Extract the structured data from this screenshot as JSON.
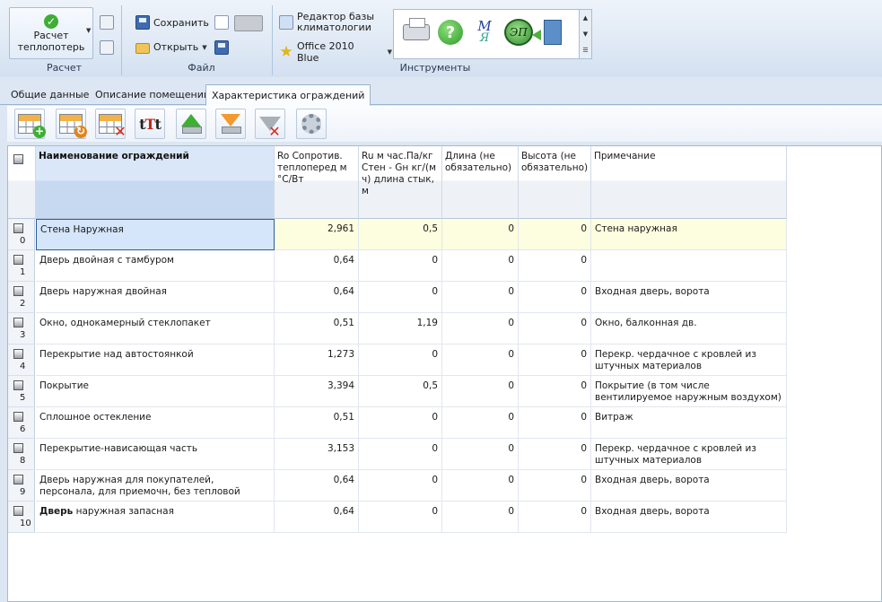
{
  "ribbon": {
    "calc": {
      "button_label": "Расчет теплопотерь",
      "group": "Расчет"
    },
    "file": {
      "save": "Сохранить",
      "open": "Открыть",
      "group": "Файл"
    },
    "tools": {
      "climate_editor": "Редактор базы климатологии",
      "theme": "Office 2010 Blue",
      "group": "Инструменты",
      "icons": [
        "printer-icon",
        "help-icon",
        "mz-logo-icon",
        "ep-logo-icon",
        "exit-door-icon"
      ]
    }
  },
  "tabs": [
    {
      "label": "Общие данные",
      "active": false
    },
    {
      "label": "Описание помещений",
      "active": false
    },
    {
      "label": "Характеристика ограждений",
      "active": true
    }
  ],
  "toolbar": {
    "icons": [
      "add-row-icon",
      "edit-row-icon",
      "delete-row-icon",
      "text-format-icon",
      "import-up-icon",
      "export-down-icon",
      "clear-filter-icon",
      "settings-icon"
    ]
  },
  "table": {
    "columns": [
      "Наименование ограждений",
      "Ro Сопротив. теплоперед м °С/Вт",
      "Ru м час.Па/кг Стен - Gн кг/(м ч) длина стык, м",
      "Длина (не обязательно)",
      "Высота (не обязательно)",
      "Примечание"
    ],
    "rows": [
      {
        "num": "0",
        "name": "Стена Наружная",
        "ro": "2,961",
        "ru": "0,5",
        "len": "0",
        "height": "0",
        "note": "Стена наружная"
      },
      {
        "num": "1",
        "name": "Дверь двойная с тамбуром",
        "ro": "0,64",
        "ru": "0",
        "len": "0",
        "height": "0",
        "note": ""
      },
      {
        "num": "2",
        "name": "Дверь наружная двойная",
        "ro": "0,64",
        "ru": "0",
        "len": "0",
        "height": "0",
        "note": "Входная дверь, ворота"
      },
      {
        "num": "3",
        "name": "Окно, однокамерный стеклопакет",
        "ro": "0,51",
        "ru": "1,19",
        "len": "0",
        "height": "0",
        "note": "Окно, балконная дв."
      },
      {
        "num": "4",
        "name": "Перекрытие над автостоянкой",
        "ro": "1,273",
        "ru": "0",
        "len": "0",
        "height": "0",
        "note": "Перекр. чердачное с кровлей из штучных материалов"
      },
      {
        "num": "5",
        "name": "Покрытие",
        "ro": "3,394",
        "ru": "0,5",
        "len": "0",
        "height": "0",
        "note": "Покрытие (в том числе вентилируемое наружным воздухом)"
      },
      {
        "num": "6",
        "name": "Сплошное остекление",
        "ro": "0,51",
        "ru": "0",
        "len": "0",
        "height": "0",
        "note": "Витраж"
      },
      {
        "num": "8",
        "name": "Перекрытие-нависающая часть",
        "ro": "3,153",
        "ru": "0",
        "len": "0",
        "height": "0",
        "note": "Перекр. чердачное с кровлей из штучных материалов"
      },
      {
        "num": "9",
        "name": "Дверь наружная для покупателей, персонала, для приемочн, без тепловой завесы",
        "ro": "0,64",
        "ru": "0",
        "len": "0",
        "height": "0",
        "note": "Входная дверь, ворота"
      },
      {
        "num": "10",
        "name_bold": "Дверь",
        "name_rest": " наружная запасная",
        "ro": "0,64",
        "ru": "0",
        "len": "0",
        "height": "0",
        "note": "Входная дверь, ворота"
      }
    ]
  }
}
